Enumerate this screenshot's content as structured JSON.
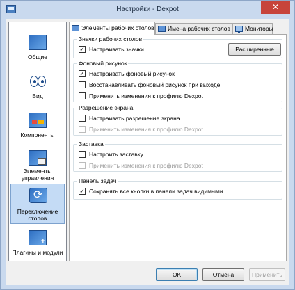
{
  "window": {
    "title": "Настройки - Dexpot",
    "close_glyph": "✕"
  },
  "sidebar": {
    "items": [
      {
        "label": "Общие",
        "icon": "desktop-icon",
        "active": false
      },
      {
        "label": "Вид",
        "icon": "eyes-icon",
        "active": false
      },
      {
        "label": "Компоненты",
        "icon": "components-icon",
        "active": false
      },
      {
        "label": "Элементы управления",
        "icon": "controls-icon",
        "active": false
      },
      {
        "label": "Переключение столов",
        "icon": "switch-icon",
        "active": true
      },
      {
        "label": "Плагины и модули",
        "icon": "plugins-icon",
        "active": false
      }
    ]
  },
  "tabs": [
    {
      "label": "Элементы рабочих столов",
      "icon": "desktop-elements-icon",
      "active": true
    },
    {
      "label": "Имена рабочих столов",
      "icon": "desktop-names-icon",
      "active": false
    },
    {
      "label": "Мониторы",
      "icon": "monitor-icon",
      "active": false
    }
  ],
  "groups": {
    "desktop_icons": {
      "title": "Значки рабочих столов",
      "options": [
        {
          "label": "Настраивать значки",
          "checked": true,
          "enabled": true
        }
      ],
      "advanced_button": "Расширенные"
    },
    "wallpaper": {
      "title": "Фоновый рисунок",
      "options": [
        {
          "label": "Настраивать фоновый рисунок",
          "checked": true,
          "enabled": true
        },
        {
          "label": "Восстанавливать фоновый рисунок при выходе",
          "checked": false,
          "enabled": true
        },
        {
          "label": "Применить изменения к профилю Dexpot",
          "checked": false,
          "enabled": true
        }
      ]
    },
    "resolution": {
      "title": "Разрешение экрана",
      "options": [
        {
          "label": "Настраивать разрешение экрана",
          "checked": false,
          "enabled": true
        },
        {
          "label": "Применить изменения к профилю Dexpot",
          "checked": false,
          "enabled": false
        }
      ]
    },
    "screensaver": {
      "title": "Заставка",
      "options": [
        {
          "label": "Настроить заставку",
          "checked": false,
          "enabled": true
        },
        {
          "label": "Применить изменения к профилю Dexpot",
          "checked": false,
          "enabled": false
        }
      ]
    },
    "taskbar": {
      "title": "Панель задач",
      "options": [
        {
          "label": "Сохранять все кнопки в панели задач видимыми",
          "checked": true,
          "enabled": true
        }
      ]
    }
  },
  "footer": {
    "ok": "OK",
    "cancel": "Отмена",
    "apply": "Применить",
    "apply_enabled": false
  },
  "colors": {
    "accent": "#c4dbf5",
    "close": "#c7443b",
    "frame": "#c9d9ee"
  }
}
